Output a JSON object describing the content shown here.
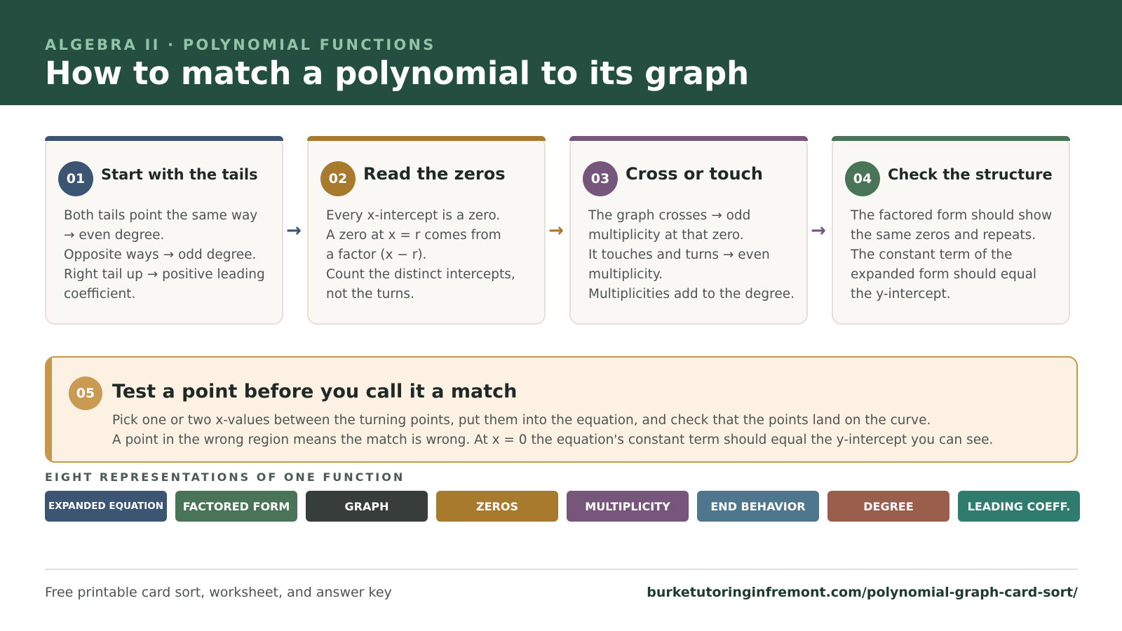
{
  "header": {
    "eyebrow": "ALGEBRA II · POLYNOMIAL FUNCTIONS",
    "title": "How to match a polynomial to its graph"
  },
  "steps": [
    {
      "number": "01",
      "title": "Start with the tails",
      "color": "#3b5573",
      "lines": [
        "Both tails point the same way",
        "→ even degree.",
        "Opposite ways → odd degree.",
        "Right tail up → positive leading",
        "coefficient."
      ]
    },
    {
      "number": "02",
      "title": "Read the zeros",
      "color": "#a87a2d",
      "lines": [
        "Every x-intercept is a zero.",
        "A zero at x = r comes from",
        "a factor (x − r).",
        "Count the distinct intercepts,",
        "not the turns."
      ]
    },
    {
      "number": "03",
      "title": "Cross or touch",
      "color": "#76567b",
      "lines": [
        "The graph crosses → odd",
        "multiplicity at that zero.",
        "It touches and turns → even",
        "multiplicity.",
        "Multiplicities add to the degree."
      ]
    },
    {
      "number": "04",
      "title": "Check the structure",
      "color": "#4a7458",
      "lines": [
        "The factored form should show",
        "the same zeros and repeats.",
        "The constant term of the",
        "expanded form should equal",
        "the y-intercept."
      ]
    }
  ],
  "arrows": {
    "icon": "arrow-right-icon",
    "glyph": "→",
    "colors": [
      "#3b5573",
      "#a87a2d",
      "#76567b"
    ]
  },
  "callout": {
    "number": "05",
    "title": "Test a point before you call it a match",
    "lines": [
      "Pick one or two x-values between the turning points, put them into the equation, and check that the points land on the curve.",
      "A point in the wrong region means the match is wrong. At x = 0 the equation's constant term should equal the y-intercept you can see."
    ],
    "accent_color": "#c8964a",
    "background": "#fcf1e2"
  },
  "representations": {
    "title": "EIGHT REPRESENTATIONS OF ONE FUNCTION",
    "items": [
      {
        "label": "EXPANDED EQUATION",
        "color": "#3b5573"
      },
      {
        "label": "FACTORED FORM",
        "color": "#4a7458"
      },
      {
        "label": "GRAPH",
        "color": "#363d3b"
      },
      {
        "label": "ZEROS",
        "color": "#a87a2d"
      },
      {
        "label": "MULTIPLICITY",
        "color": "#76567b"
      },
      {
        "label": "END BEHAVIOR",
        "color": "#4e778e"
      },
      {
        "label": "DEGREE",
        "color": "#9a5e4c"
      },
      {
        "label": "LEADING COEFF.",
        "color": "#2f7b6d"
      }
    ]
  },
  "footer": {
    "left": "Free printable card sort, worksheet, and answer key",
    "url": "burketutoringinfremont.com/polynomial-graph-card-sort/"
  },
  "colors": {
    "header_background": "#244e3f",
    "eyebrow": "#8fc4a6",
    "card_background": "#faf8f5"
  }
}
